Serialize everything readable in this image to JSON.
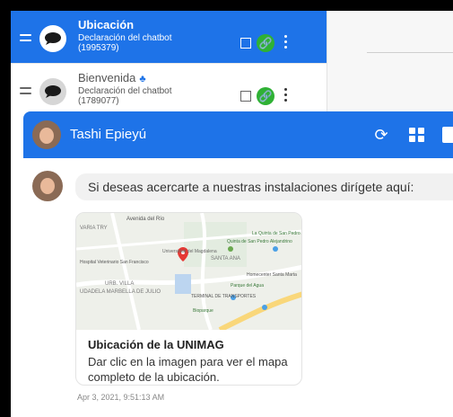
{
  "flow_list": {
    "items": [
      {
        "title": "Ubicación",
        "subtitle": "Declaración del chatbot (1995379)",
        "active": true
      },
      {
        "title": "Bienvenida",
        "subtitle": "Declaración del chatbot (1789077)",
        "active": false,
        "group_icon": "people-icon"
      }
    ]
  },
  "chat": {
    "contact_name": "Tashi Epieyú",
    "header_icons": [
      "refresh-icon",
      "transfer-icon",
      "more-icon"
    ],
    "message": {
      "text": "Si deseas acercarte a nuestras instalaciones dirígete aquí:",
      "location_card": {
        "title": "Ubicación de la UNIMAG",
        "description": "Dar clic en la imagen para ver el mapa completo de la ubicación.",
        "map_labels": [
          "Avenida del Río",
          "VARIA TRY",
          "Hospital Veterinario San Francisco",
          "Universidad del Magdalena",
          "Quinta de San Pedro Alejandrino",
          "SANTA ANA",
          "URB. VILLA",
          "UDADELA MARBELLA DE JULIO",
          "Parque del Agua",
          "TERMINAL DE TRANSPORTES",
          "Bioparque",
          "La Quinta de San Pedro Alejandrino",
          "Homecenter Santa Marta"
        ]
      },
      "timestamp": "Apr 3, 2021, 9:51:13 AM"
    }
  },
  "colors": {
    "primary": "#1e73e8",
    "link_button": "#2fb135",
    "map_pin": "#e53935"
  }
}
